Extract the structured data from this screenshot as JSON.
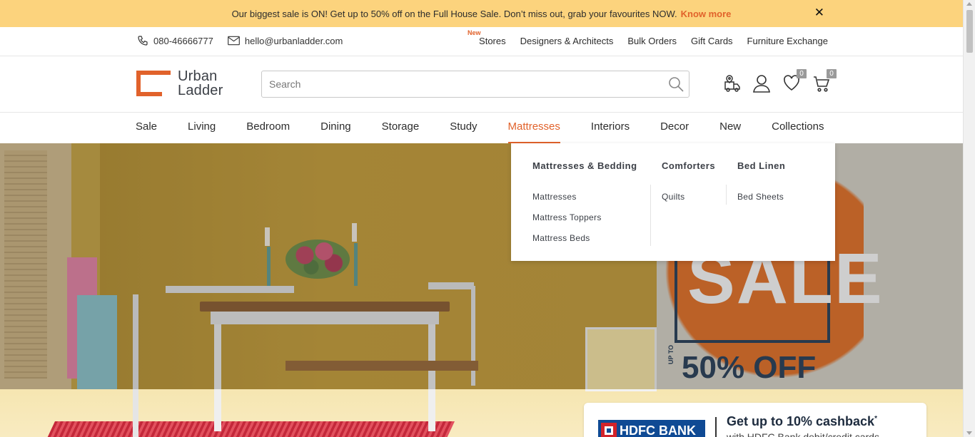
{
  "announcement": {
    "text": "Our biggest sale is ON! Get up to 50% off on the Full House Sale. Don’t miss out, grab your favourites NOW.",
    "link": "Know more",
    "close": "✕"
  },
  "utility": {
    "phone": "080-46666777",
    "email": "hello@urbanladder.com",
    "new_tag": "New",
    "links": [
      "Stores",
      "Designers & Architects",
      "Bulk Orders",
      "Gift Cards",
      "Furniture Exchange"
    ]
  },
  "header": {
    "logo_line1": "Urban",
    "logo_line2": "Ladder",
    "search_placeholder": "Search",
    "wishlist_count": "0",
    "cart_count": "0"
  },
  "nav": {
    "items": [
      "Sale",
      "Living",
      "Bedroom",
      "Dining",
      "Storage",
      "Study",
      "Mattresses",
      "Interiors",
      "Decor",
      "New",
      "Collections"
    ],
    "active": "Mattresses"
  },
  "dropdown": {
    "columns": [
      {
        "title": "Mattresses & Bedding",
        "items": [
          "Mattresses",
          "Mattress Toppers",
          "Mattress Beds"
        ]
      },
      {
        "title": "Comforters",
        "items": [
          "Quilts"
        ]
      },
      {
        "title": "Bed Linen",
        "items": [
          "Bed Sheets"
        ]
      }
    ]
  },
  "hero": {
    "sale_word": "SALE",
    "upto": "UP TO",
    "discount": "50% OFF",
    "bank": "HDFC BANK",
    "cashback": "Get up to 10% cashback",
    "cashback_mark": "*",
    "cashback_sub": "with HDFC Bank debit/credit cards"
  },
  "colors": {
    "accent": "#e1622b",
    "announcement_bg": "#fcd37d",
    "text_dark": "#2c2c2c"
  }
}
